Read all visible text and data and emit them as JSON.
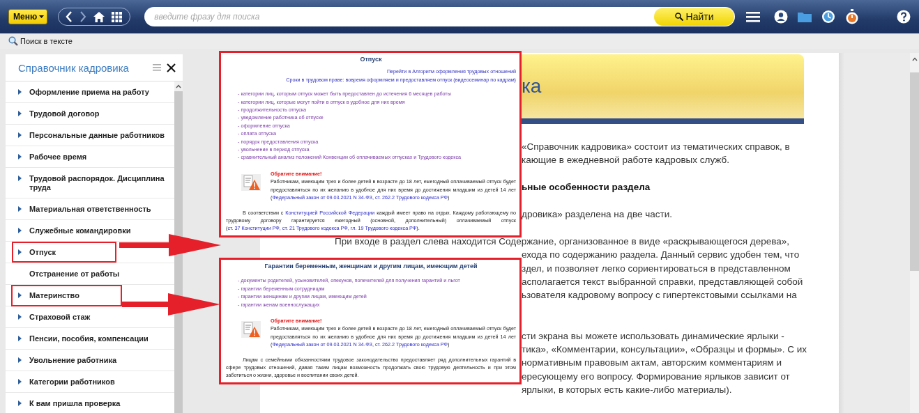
{
  "toolbar": {
    "menu_button": "Меню",
    "search": {
      "placeholder": "введите фразу для поиска"
    },
    "search_button": "Найти"
  },
  "find_in_text": "Поиск в тексте",
  "sidebar": {
    "title": "Справочник кадровика",
    "items": [
      {
        "label": "Оформление приема на работу",
        "expandable": true,
        "highlighted": false
      },
      {
        "label": "Трудовой договор",
        "expandable": true,
        "highlighted": false
      },
      {
        "label": "Персональные данные работников",
        "expandable": true,
        "highlighted": false
      },
      {
        "label": "Рабочее время",
        "expandable": true,
        "highlighted": false
      },
      {
        "label": "Трудовой распорядок. Дисциплина труда",
        "expandable": true,
        "highlighted": false
      },
      {
        "label": "Материальная ответственность",
        "expandable": true,
        "highlighted": false
      },
      {
        "label": "Служебные командировки",
        "expandable": true,
        "highlighted": false
      },
      {
        "label": "Отпуск",
        "expandable": true,
        "highlighted": true
      },
      {
        "label": "Отстранение от работы",
        "expandable": false,
        "highlighted": false
      },
      {
        "label": "Материнство",
        "expandable": true,
        "highlighted": true
      },
      {
        "label": "Страховой стаж",
        "expandable": true,
        "highlighted": false
      },
      {
        "label": "Пенсии, пособия, компенсации",
        "expandable": true,
        "highlighted": false
      },
      {
        "label": "Увольнение работника",
        "expandable": true,
        "highlighted": false
      },
      {
        "label": "Категории работников",
        "expandable": true,
        "highlighted": false
      },
      {
        "label": "К вам пришла проверка",
        "expandable": true,
        "highlighted": false
      }
    ]
  },
  "document": {
    "title_fragment": "ка",
    "paragraphs": [
      {
        "kind": "text",
        "lines": [
          {
            "text": "«Справочник кадровика»  состоит из тематических справок, в",
            "kind": "fragment"
          },
          {
            "text": "кающие в ежедневной работе кадровых служб.",
            "kind": "fragment"
          }
        ]
      },
      {
        "kind": "heading",
        "lines": [
          {
            "text": "ьные особенности раздела",
            "kind": "fragment"
          }
        ]
      },
      {
        "kind": "text",
        "lines": [
          {
            "text": "дровика» разделена на две части.",
            "kind": "fragment"
          }
        ]
      },
      {
        "kind": "text",
        "lines": [
          {
            "text": "При входе в раздел слева находится Содержание, организованное в виде «раскрывающегося дерева»,",
            "kind": "full"
          },
          {
            "text": "ехода по содержанию раздела. Данный сервис удобен тем, что",
            "kind": "fragment"
          },
          {
            "text": "здел, и позволяет легко сориентироваться в представленном",
            "kind": "fragment"
          },
          {
            "text": "асполагается текст выбранной справки, представляющей собой",
            "kind": "fragment"
          },
          {
            "text": "ьзователя кадровому вопросу с гипертекстовыми ссылками на",
            "kind": "fragment"
          }
        ]
      },
      {
        "kind": "text",
        "lines": [
          {
            "text": "сти экрана вы можете использовать динамические ярлыки -",
            "kind": "fragment"
          },
          {
            "text": "тика», «Комментарии, консультации», «Образцы и формы». С их",
            "kind": "fragment"
          },
          {
            "text": "нормативным правовым актам, авторским комментариям и",
            "kind": "fragment"
          },
          {
            "text": "ересующему его вопросу. Формирование ярлыков зависит от",
            "kind": "fragment"
          },
          {
            "text": "ярлыки, в которых есть какие-либо материалы).",
            "kind": "fragment"
          }
        ]
      }
    ]
  },
  "insets": [
    {
      "title": "Отпуск",
      "top_links": [
        "Перейти в Алгоритм оформления трудовых отношений",
        "Сроки в трудовом праве: вовремя оформляем и предоставляем отпуск (видеосеминар по кадрам)"
      ],
      "list": [
        "- категории лиц, которым отпуск может быть предоставлен до истечения 6 месяцев работы",
        "- категории лиц, которые могут пойти в отпуск в удобное для них время",
        "- продолжительность отпуска",
        "- уведомление работника об отпуске",
        "- оформление отпуска",
        "- оплата отпуска",
        "- порядок предоставления отпуска",
        "- увольнение в период отпуска",
        "- сравнительный анализ положений Конвенции об оплачиваемых отпусках и Трудового кодекса"
      ],
      "notice": {
        "title": "Обратите внимание!",
        "segments": [
          {
            "text": "Работникам, имеющим трех и более детей в возрасте до 18 лет, ежегодный оплачиваемый отпуск будет предоставляться по их желанию в удобное для них время до достижения младшим из детей 14 лет (",
            "kind": "text"
          },
          {
            "text": "Федеральный закон от 09.03.2021 N 34-ФЗ, ст. 262.2 Трудового кодекса РФ",
            "kind": "link"
          },
          {
            "text": ")",
            "kind": "text"
          }
        ]
      },
      "paragraph": [
        {
          "text": "В соответствии с ",
          "kind": "text"
        },
        {
          "text": "Конституцией Российской Федерации",
          "kind": "link"
        },
        {
          "text": " каждый имеет право на отдых. Каждому работающему по трудовому договору гарантируется ежегодный (основной, дополнительный) оплачиваемый отпуск (",
          "kind": "text"
        },
        {
          "text": "ст. 37 Конституции РФ, ст. 21 Трудового кодекса РФ, гл. 19 Трудового кодекса РФ",
          "kind": "link"
        },
        {
          "text": ").",
          "kind": "text"
        }
      ]
    },
    {
      "title": "Гарантии беременным, женщинам и другим лицам, имеющим детей",
      "list": [
        "- документы родителей, усыновителей, опекунов, попечителей для получения гарантий и льгот",
        "- гарантии беременным сотрудницам",
        "- гарантии женщинам и другим лицам, имеющим детей",
        "- гарантии женам военнослужащих"
      ],
      "notice": {
        "title": "Обратите внимание!",
        "segments": [
          {
            "text": "Работникам, имеющим трех и более детей в возрасте до 18 лет, ежегодный оплачиваемый отпуск будет предоставляться по их желанию в удобное для них время до достижения младшим из детей 14 лет (",
            "kind": "text"
          },
          {
            "text": "Федеральный закон от 09.03.2021 N 34-ФЗ, ст. 262.2 Трудового кодекса РФ",
            "kind": "link"
          },
          {
            "text": ")",
            "kind": "text"
          }
        ]
      },
      "paragraph": [
        {
          "text": "Лицам с семейными обязанностями трудовое законодательство предоставляет ряд дополнительных гарантий в сфере трудовых отношений, давая таким лицам возможность продолжать свою трудовую деятельность и при этом заботиться о жизни, здоровье и воспитании своих детей.",
          "kind": "text"
        }
      ]
    }
  ]
}
